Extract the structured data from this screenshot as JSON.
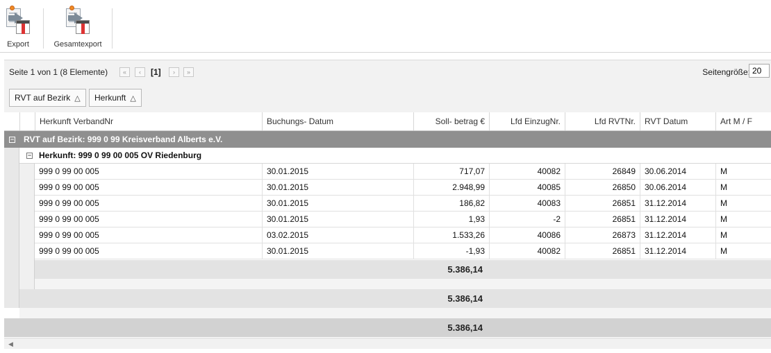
{
  "toolbar": {
    "buttons": [
      {
        "label": "Export",
        "icon": "export-icon"
      },
      {
        "label": "Gesamtexport",
        "icon": "full-export-icon"
      }
    ]
  },
  "pager": {
    "info": "Seite 1 von 1 (8 Elemente)",
    "current_page": "[1]",
    "first": "«",
    "prev": "‹",
    "next": "›",
    "last": "»",
    "page_size_label": "Seitengröße:",
    "page_size_value": "20"
  },
  "group_panel": {
    "chips": [
      {
        "label": "RVT auf Bezirk",
        "sort": "△"
      },
      {
        "label": "Herkunft",
        "sort": "△"
      }
    ]
  },
  "grid": {
    "columns": [
      "Herkunft VerbandNr",
      "Buchungs- Datum",
      "Soll- betrag €",
      "Lfd EinzugNr.",
      "Lfd RVTNr.",
      "RVT Datum",
      "Art M / F"
    ],
    "group1": {
      "toggle": "−",
      "label": "RVT auf Bezirk: 999 0 99 Kreisverband Alberts e.V."
    },
    "group2": {
      "toggle": "−",
      "label": "Herkunft: 999 0 99 00 005 OV Riedenburg"
    },
    "rows": [
      [
        "999 0 99 00 005",
        "30.01.2015",
        "717,07",
        "40082",
        "26849",
        "30.06.2014",
        "M"
      ],
      [
        "999 0 99 00 005",
        "30.01.2015",
        "2.948,99",
        "40085",
        "26850",
        "30.06.2014",
        "M"
      ],
      [
        "999 0 99 00 005",
        "30.01.2015",
        "186,82",
        "40083",
        "26851",
        "31.12.2014",
        "M"
      ],
      [
        "999 0 99 00 005",
        "30.01.2015",
        "1,93",
        "-2",
        "26851",
        "31.12.2014",
        "M"
      ],
      [
        "999 0 99 00 005",
        "03.02.2015",
        "1.533,26",
        "40086",
        "26873",
        "31.12.2014",
        "M"
      ],
      [
        "999 0 99 00 005",
        "30.01.2015",
        "-1,93",
        "40082",
        "26851",
        "31.12.2014",
        "M"
      ]
    ],
    "footer_herkunft": "5.386,14",
    "footer_bezirk": "5.386,14",
    "footer_total": "5.386,14"
  },
  "colors": {
    "group_header": "#8f8f8f",
    "footer": "#e3e3e3",
    "badge": "#f08a24",
    "red_bar": "#dd3333"
  }
}
